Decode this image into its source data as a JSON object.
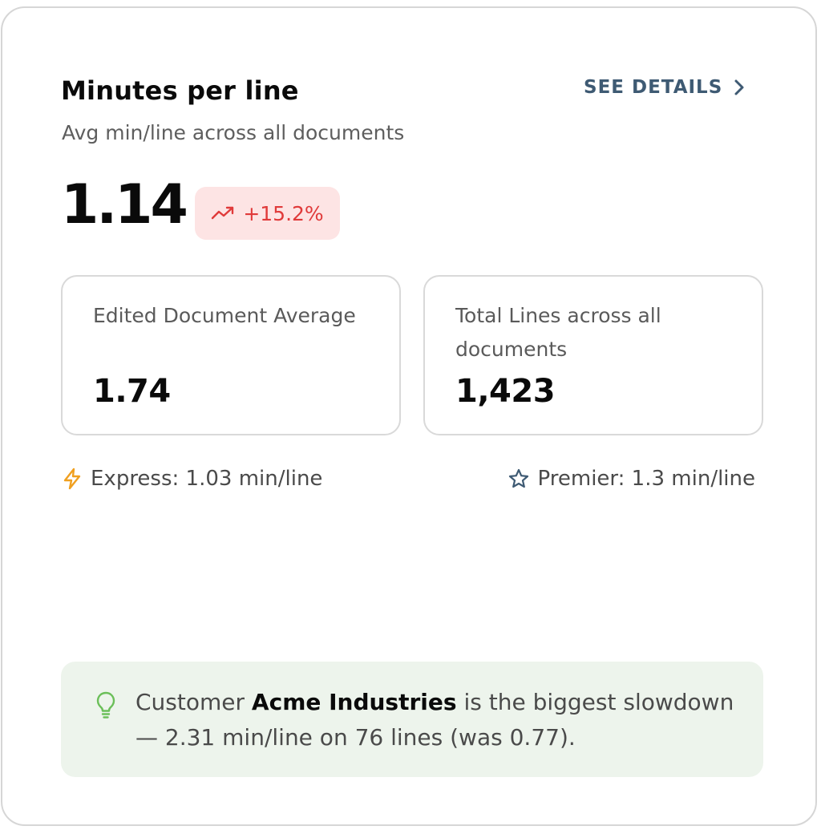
{
  "card": {
    "title": "Minutes per line",
    "subtitle": "Avg min/line across all documents",
    "see_details_label": "SEE DETAILS",
    "value": "1.14",
    "trend": {
      "label": "+15.2%",
      "direction": "up",
      "color": "#e03a3a",
      "background": "#fde4e4"
    }
  },
  "stats": [
    {
      "label": "Edited Document Average",
      "value": "1.74"
    },
    {
      "label": "Total Lines across all documents",
      "value": "1,423"
    }
  ],
  "tiers": {
    "express": {
      "icon": "lightning-icon",
      "label": "Express: 1.03 min/line",
      "color": "#f0a020"
    },
    "premier": {
      "icon": "star-icon",
      "label": "Premier: 1.3 min/line",
      "color": "#3e5a73"
    }
  },
  "insight": {
    "icon": "lightbulb-icon",
    "prefix": "Customer ",
    "customer": "Acme Industries",
    "suffix": " is the biggest slowdown — 2.31 min/line on 76 lines (was 0.77).",
    "background": "#edf4ec",
    "icon_color": "#6bbf59"
  }
}
